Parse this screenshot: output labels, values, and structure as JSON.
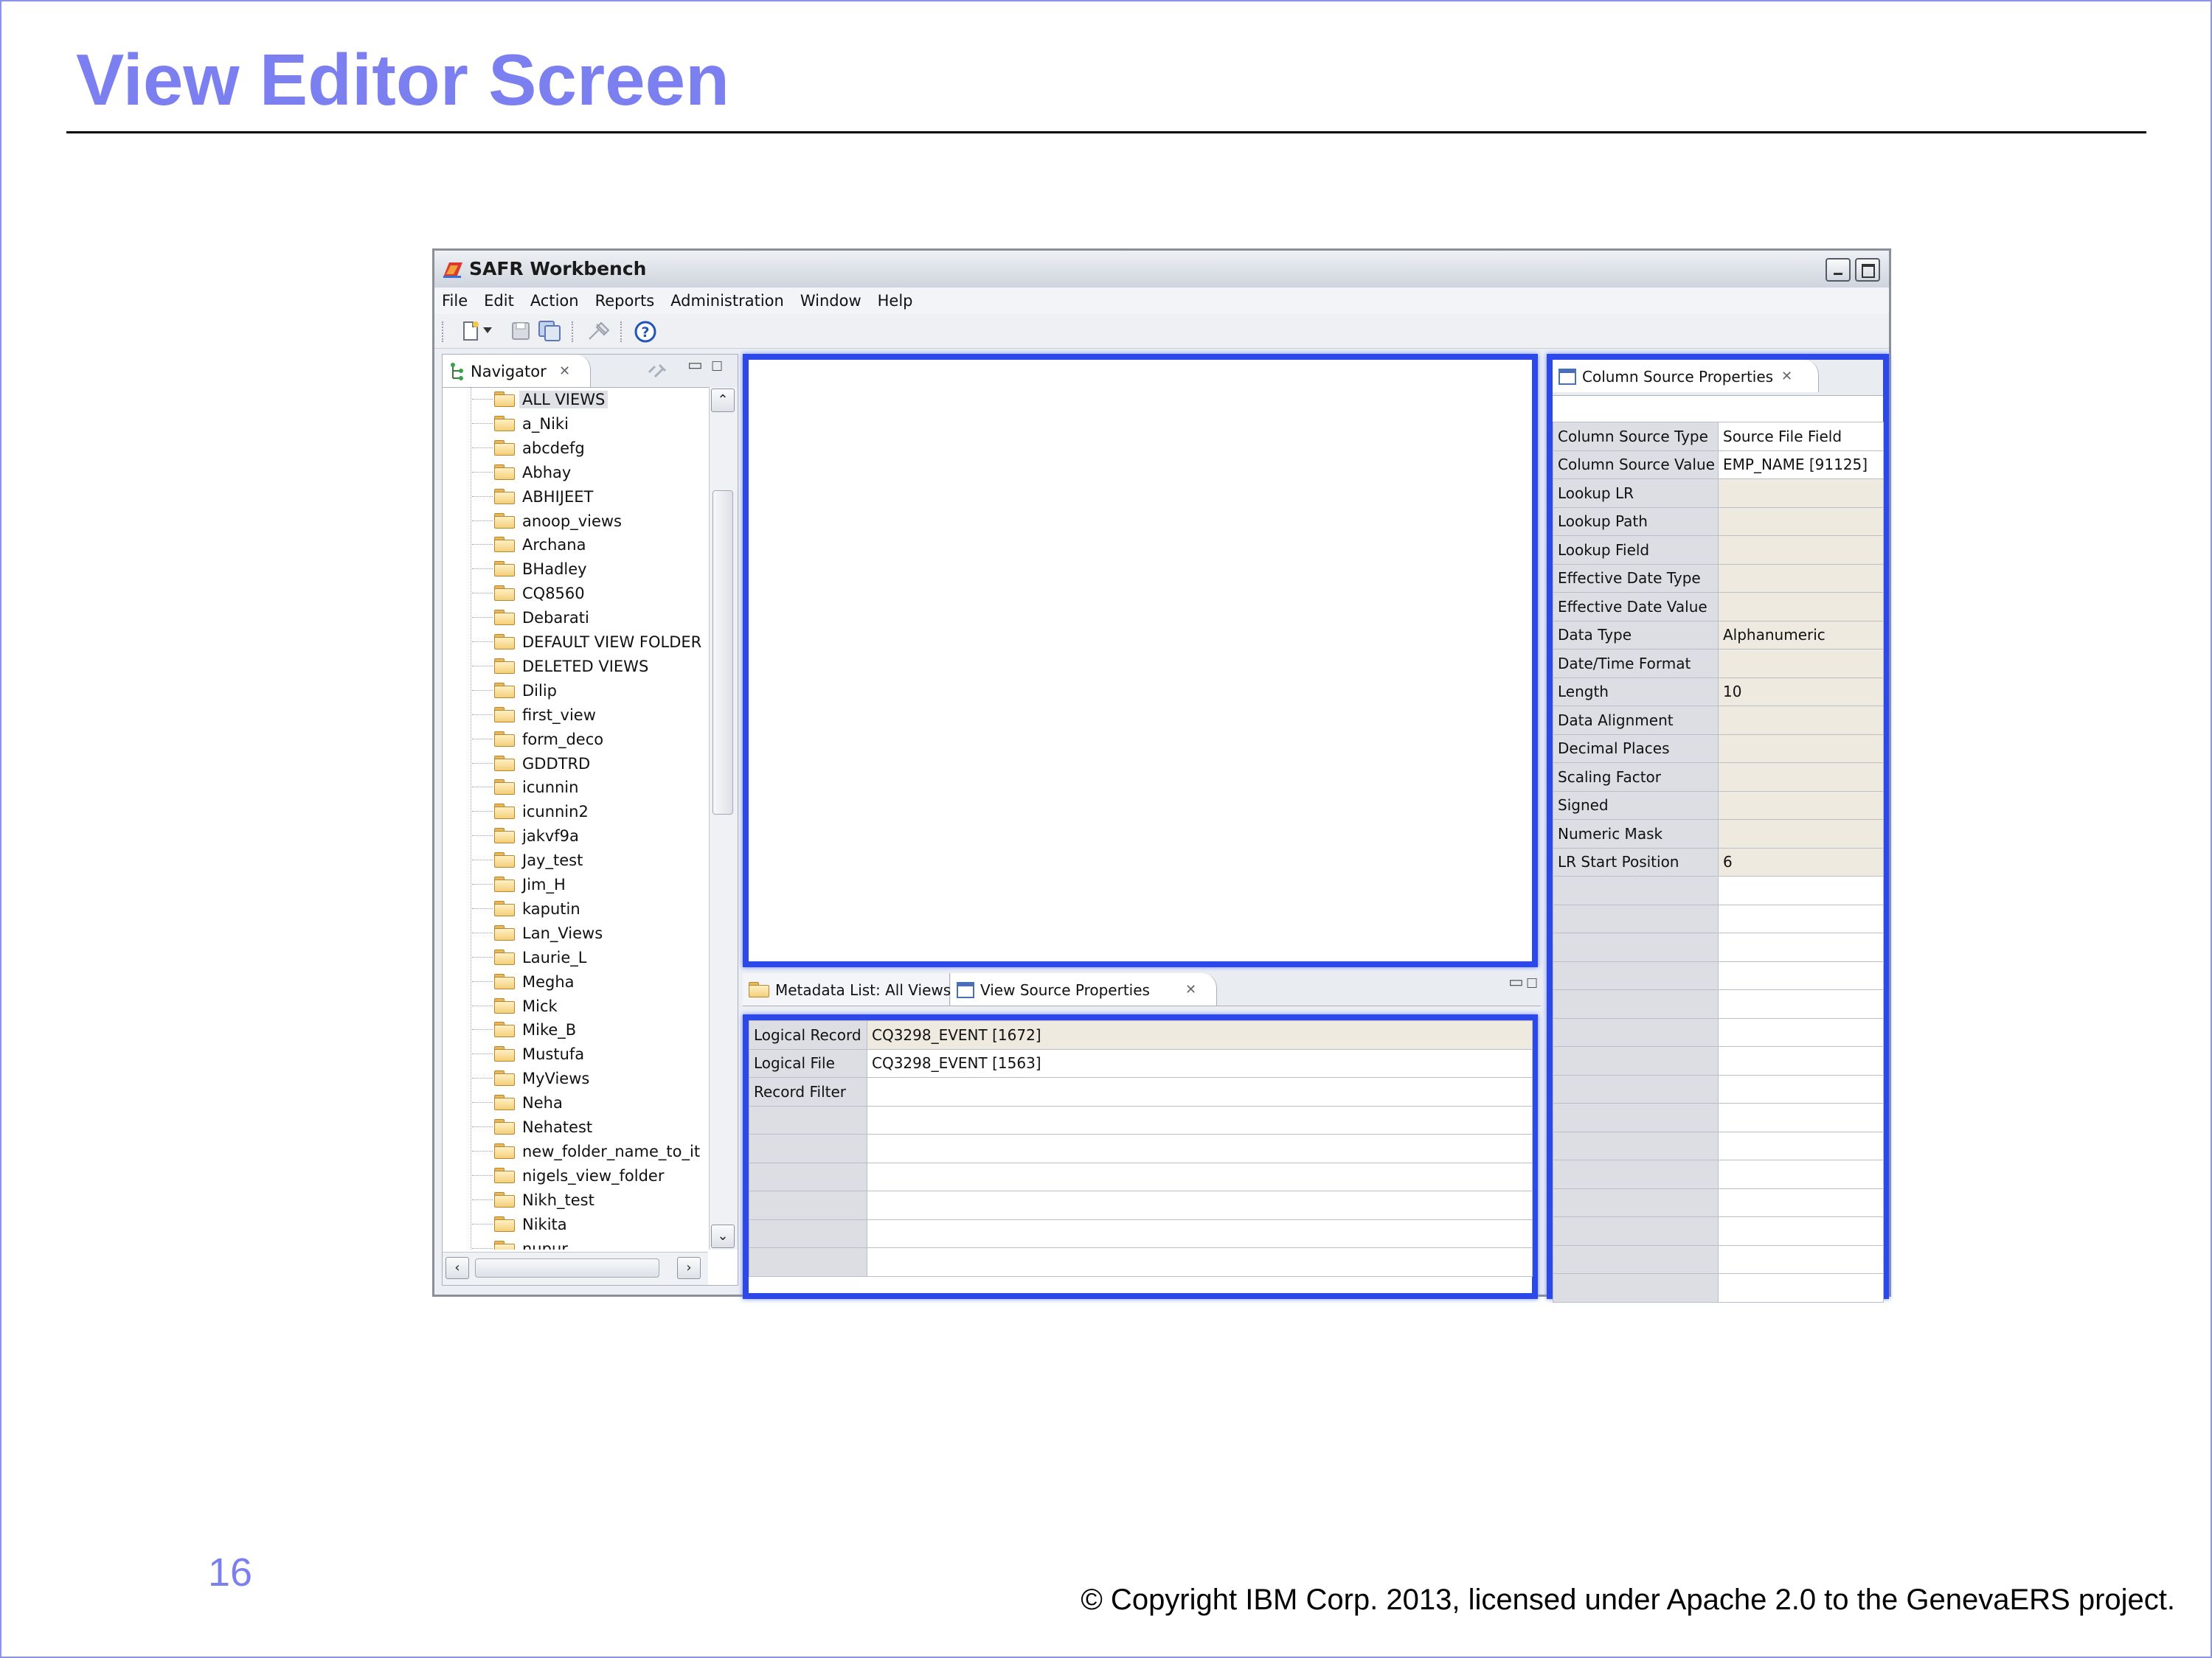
{
  "slide": {
    "title": "View Editor Screen",
    "page_number": "16",
    "copyright": "© Copyright IBM Corp. 2013, licensed under Apache 2.0 to the GenevaERS project.",
    "title_color": "#7b7ff0",
    "highlight_color": "#2c48e8"
  },
  "app": {
    "title": "SAFR Workbench",
    "menu": [
      "File",
      "Edit",
      "Action",
      "Reports",
      "Administration",
      "Window",
      "Help"
    ],
    "toolbar_icons": [
      "new-icon",
      "dropdown-arrow-icon",
      "save-icon",
      "save-all-icon",
      "pin-icon",
      "help-icon"
    ]
  },
  "navigator": {
    "tab_label": "Navigator",
    "items": [
      "ALL VIEWS",
      "a_Niki",
      "abcdefg",
      "Abhay",
      "ABHIJEET",
      "anoop_views",
      "Archana",
      "BHadley",
      "CQ8560",
      "Debarati",
      "DEFAULT VIEW FOLDER",
      "DELETED VIEWS",
      "Dilip",
      "first_view",
      "form_deco",
      "GDDTRD",
      "icunnin",
      "icunnin2",
      "jakvf9a",
      "Jay_test",
      "Jim_H",
      "kaputin",
      "Lan_Views",
      "Laurie_L",
      "Megha",
      "Mick",
      "Mike_B",
      "Mustufa",
      "MyViews",
      "Neha",
      "Nehatest",
      "new_folder_name_to_it",
      "nigels_view_folder",
      "Nikh_test",
      "Nikita",
      "nupur"
    ],
    "selected": "ALL VIEWS"
  },
  "bottom_tabs": {
    "metadata_tab": "Metadata List: All Views",
    "view_source_tab": "View Source Properties"
  },
  "view_source": {
    "rows": [
      {
        "key": "Logical Record",
        "value": "CQ3298_EVENT [1672]"
      },
      {
        "key": "Logical File",
        "value": "CQ3298_EVENT [1563]"
      },
      {
        "key": "Record Filter",
        "value": ""
      }
    ]
  },
  "column_source": {
    "tab_label": "Column Source Properties",
    "rows": [
      {
        "key": "Column Source Type",
        "value": "Source File Field"
      },
      {
        "key": "Column Source Value",
        "value": "EMP_NAME [91125]"
      },
      {
        "key": "Lookup LR",
        "value": ""
      },
      {
        "key": "Lookup Path",
        "value": ""
      },
      {
        "key": "Lookup Field",
        "value": ""
      },
      {
        "key": "Effective Date Type",
        "value": ""
      },
      {
        "key": "Effective Date Value",
        "value": ""
      },
      {
        "key": "Data Type",
        "value": "Alphanumeric"
      },
      {
        "key": "Date/Time Format",
        "value": ""
      },
      {
        "key": "Length",
        "value": "10"
      },
      {
        "key": "Data Alignment",
        "value": ""
      },
      {
        "key": "Decimal Places",
        "value": ""
      },
      {
        "key": "Scaling Factor",
        "value": ""
      },
      {
        "key": "Signed",
        "value": ""
      },
      {
        "key": "Numeric Mask",
        "value": ""
      },
      {
        "key": "LR Start Position",
        "value": "6"
      }
    ]
  }
}
